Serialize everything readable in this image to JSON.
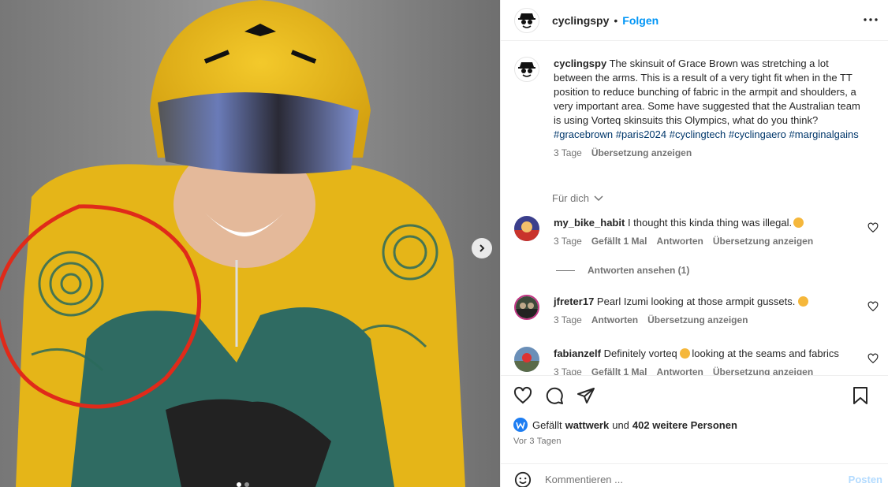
{
  "media": {
    "image_description_icon": "photo",
    "next_icon": "chevron-right-icon",
    "carousel_count": 2,
    "carousel_active": 1
  },
  "header": {
    "username": "cyclingspy",
    "separator": "•",
    "follow_label": "Folgen",
    "more_icon": "more-horizontal-icon"
  },
  "caption": {
    "username": "cyclingspy",
    "text": " The skinsuit of Grace Brown was stretching a lot between the arms. This is a result of a very tight fit when in the TT position to reduce bunching of fabric in the armpit and shoulders, a very important area. Some have suggested that the Australian team is using Vorteq skinsuits this Olympics, what do you think? ",
    "hashtags": [
      "#gracebrown",
      "#paris2024",
      "#cyclingtech",
      "#cyclingaero",
      "#marginalgains"
    ],
    "time": "3 Tage",
    "translate_label": "Übersetzung anzeigen"
  },
  "for_you_label": "Für dich",
  "comments": [
    {
      "username": "my_bike_habit",
      "text": " I thought this kinda thing was illegal.",
      "time": "3 Tage",
      "likes": "Gefällt 1 Mal",
      "reply_label": "Antworten",
      "translate_label": "Übersetzung anzeigen"
    },
    {
      "username": "jfreter17",
      "text": " Pearl Izumi looking at those armpit gussets. ",
      "time": "3 Tage",
      "reply_label": "Antworten",
      "translate_label": "Übersetzung anzeigen"
    },
    {
      "username": "fabianzelf",
      "text": " Definitely vorteq ",
      "text_after": "looking at the seams and fabrics",
      "time": "3 Tage",
      "likes": "Gefällt 1 Mal",
      "reply_label": "Antworten",
      "translate_label": "Übersetzung anzeigen"
    }
  ],
  "view_replies_label": "Antworten ansehen (1)",
  "likes_bar": {
    "prefix": "Gefällt",
    "user": "wattwerk",
    "middle": "und",
    "others": "402 weitere Personen",
    "time": "Vor 3 Tagen"
  },
  "add_comment": {
    "placeholder": "Kommentieren ...",
    "post_label": "Posten"
  },
  "colors": {
    "accent": "#0095f6",
    "hashtag": "#00376b",
    "muted": "#737373",
    "post_disabled": "#b3dbff"
  }
}
